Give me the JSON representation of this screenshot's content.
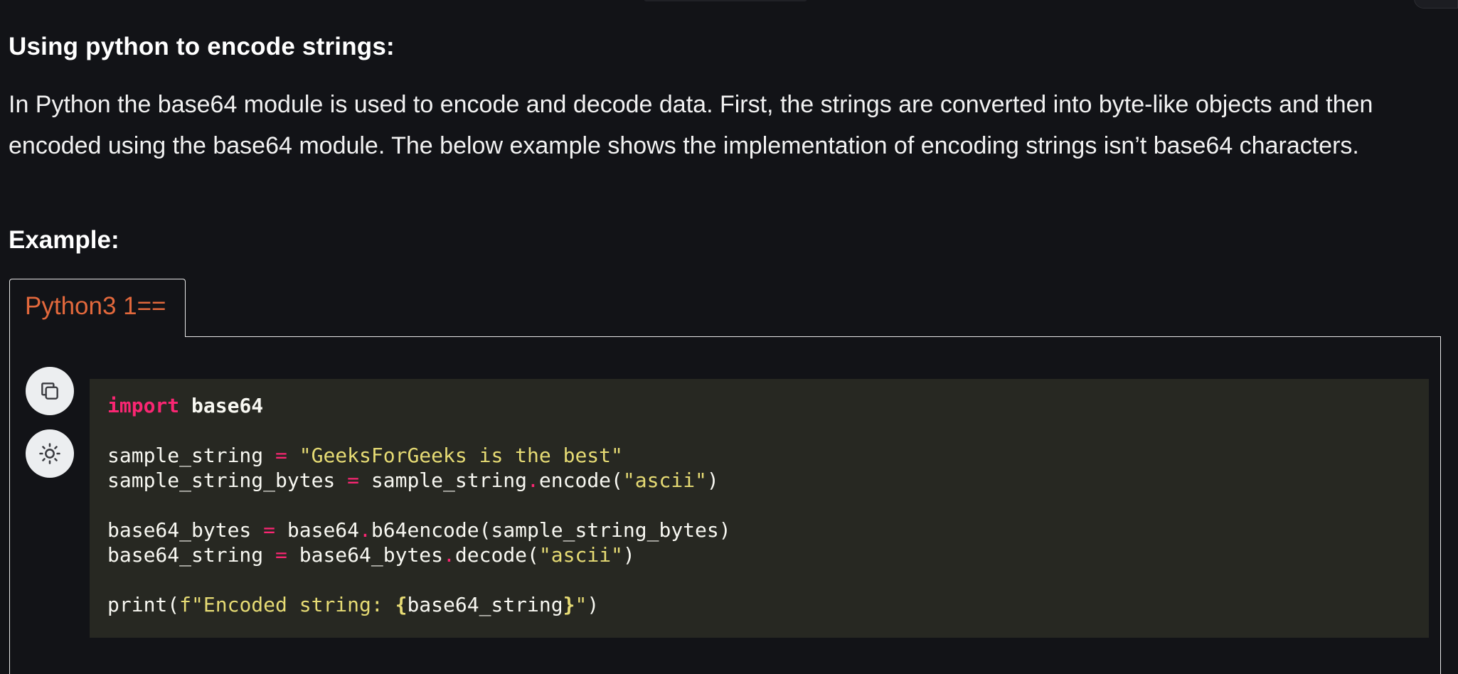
{
  "section_title": "Using python to encode strings:",
  "paragraph": "In Python the base64 module is used to encode and decode data. First, the strings are converted into byte-like objects and then encoded using the base64 module. The below example shows the implementation of encoding strings isn’t base64 characters.",
  "example_label": "Example:",
  "code_tab": {
    "label": "Python3 1=="
  },
  "toolbar": {
    "copy_icon": "copy-icon",
    "theme_icon": "sun-icon"
  },
  "colors": {
    "background": "#121317",
    "code_background": "#272822",
    "keyword": "#f92672",
    "string": "#e6db74",
    "tab_label": "#e2683c"
  },
  "code": {
    "l1_kw": "import",
    "l1_mod": " base64",
    "l3_var": "sample_string ",
    "l3_op": "=",
    "l3_str": " \"GeeksForGeeks is the best\"",
    "l4_var": "sample_string_bytes ",
    "l4_op": "=",
    "l4_obj": " sample_string",
    "l4_dot": ".",
    "l4_call": "encode(",
    "l4_str": "\"ascii\"",
    "l4_end": ")",
    "l6_var": "base64_bytes ",
    "l6_op": "=",
    "l6_obj": " base64",
    "l6_dot": ".",
    "l6_call": "b64encode(sample_string_bytes)",
    "l7_var": "base64_string ",
    "l7_op": "=",
    "l7_obj": " base64_bytes",
    "l7_dot": ".",
    "l7_call": "decode(",
    "l7_str": "\"ascii\"",
    "l7_end": ")",
    "l9_call": "print(",
    "l9_str1": "f\"Encoded string: ",
    "l9_brace1": "{",
    "l9_var": "base64_string",
    "l9_brace2": "}",
    "l9_str2": "\"",
    "l9_end": ")"
  }
}
